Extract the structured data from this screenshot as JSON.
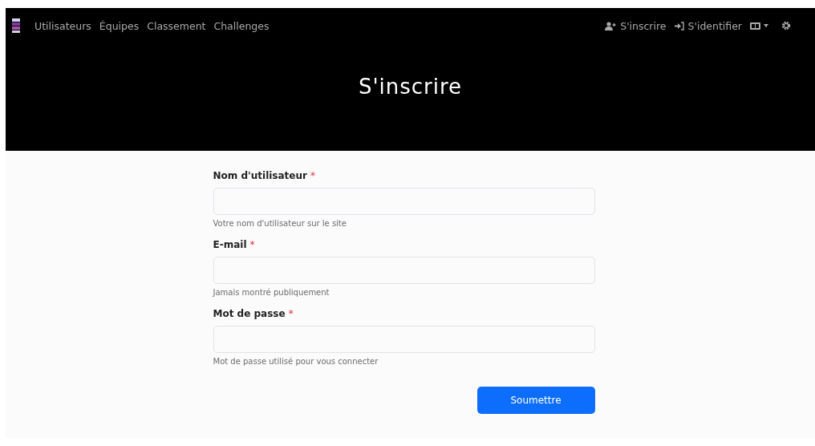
{
  "navbar": {
    "links": [
      {
        "label": "Utilisateurs"
      },
      {
        "label": "Équipes"
      },
      {
        "label": "Classement"
      },
      {
        "label": "Challenges"
      }
    ],
    "register": "S'inscrire",
    "login": "S'identifier"
  },
  "hero": {
    "title": "S'inscrire"
  },
  "form": {
    "fields": [
      {
        "label": "Nom d'utilisateur",
        "required_mark": "*",
        "help": "Votre nom d'utilisateur sur le site"
      },
      {
        "label": "E-mail",
        "required_mark": "*",
        "help": "Jamais montré publiquement"
      },
      {
        "label": "Mot de passe",
        "required_mark": "*",
        "help": "Mot de passe utilisé pour vous connecter"
      }
    ],
    "submit": "Soumettre"
  }
}
